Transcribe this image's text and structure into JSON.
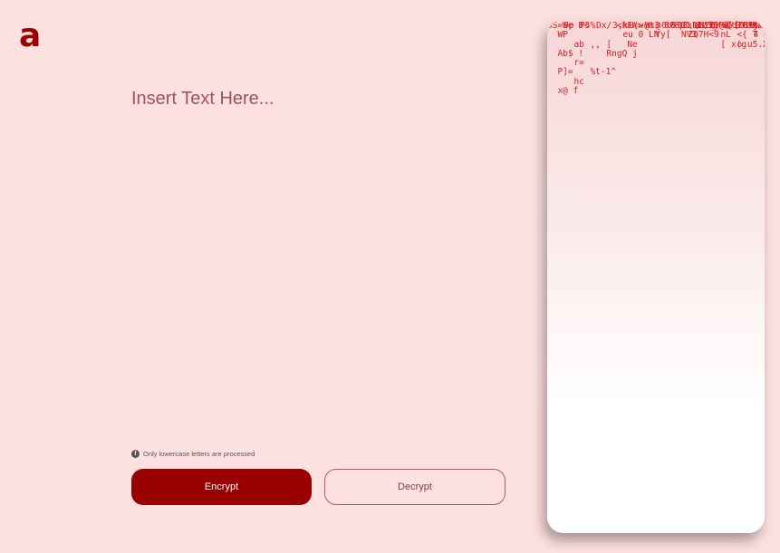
{
  "logo": {
    "mark": "a"
  },
  "editor": {
    "placeholder": "Insert Text Here..."
  },
  "note": {
    "text": "Only lowercase letters are processed",
    "icon": "info-icon"
  },
  "buttons": {
    "encrypt_label": "Encrypt",
    "decrypt_label": "Decrypt"
  },
  "colors": {
    "background": "#fde0e0",
    "accent": "#9a0000",
    "matrix": "#d72020"
  },
  "matrix": {
    "columns": [
      "SS=We B\n  WP\n  \n  Ab$ !\n  \n  P]=\n  \n  x@ f\n  ",
      "9p  <\n  \n  ab  \n  \n  r=\n  \n  hc",
      "P5%\n  \n  ,,\n  \n  \n  %t-1^\n  \n  ",
      "Dx/ <hE#>\n  \n  [   Ne\n  RngQ j",
      "3,k- w m  8?8p\n  eu 0 LN\n  ",
      "U,-@t3  0 u1 IV3@ &{ ZH7jSPCO",
      "W @ \n  Yy[  NV3\n  ",
      "6b9^T\\D1'i6PeY[9 U",
      "93:\\L1Z_@k\n  ZQ7H<9\n  ",
      "oN/_) [ B zK:J[]R Uo W k>U",
      "E/\n  nL\n  [ x(g  \n  ",
      "Cd-t!K#f\n  <{ T\n  o u5.X@",
      "0-8  \\\n  4 6Yr@"
    ]
  }
}
